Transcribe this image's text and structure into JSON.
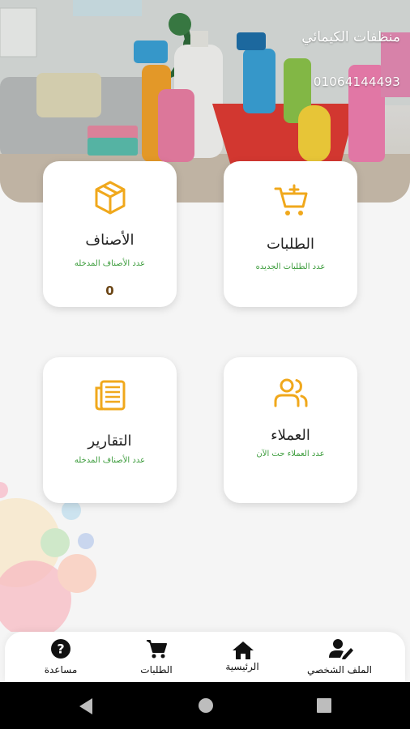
{
  "header": {
    "store_name": "منظفات الكيمائي",
    "phone": "01064144493"
  },
  "cards": {
    "categories": {
      "title": "الأصناف",
      "subtitle": "عدد الأصناف المدخله",
      "count": "0"
    },
    "orders": {
      "title": "الطلبات",
      "subtitle": "عدد الطلبات الجديده"
    },
    "reports": {
      "title": "التقارير",
      "subtitle": "عدد الأصناف المدخله"
    },
    "customers": {
      "title": "العملاء",
      "subtitle": "عدد العملاء حت الآن"
    }
  },
  "bottom_nav": {
    "help": "مساعدة",
    "orders": "الطلبات",
    "home": "الرئيسية",
    "profile": "الملف الشخصي"
  },
  "colors": {
    "accent_icon": "#f0a81c",
    "subtitle_green": "#3c9c3c",
    "count_brown": "#6b4515"
  },
  "icons": {
    "categories": "box-icon",
    "orders": "cart-plus-icon",
    "reports": "newspaper-icon",
    "customers": "users-icon"
  }
}
